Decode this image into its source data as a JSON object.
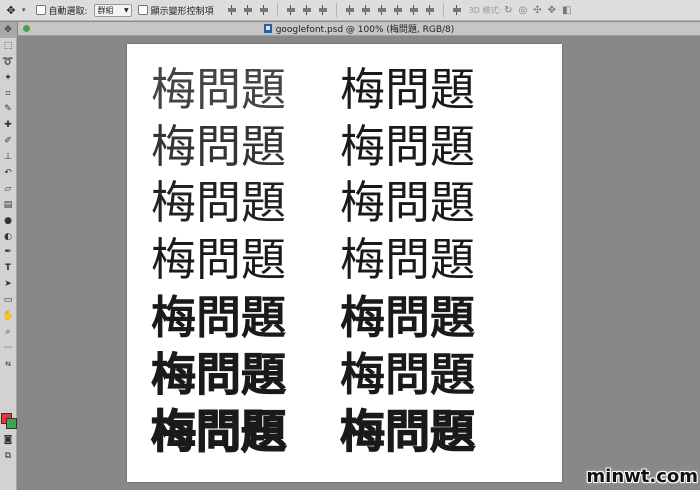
{
  "options_bar": {
    "auto_select_label": "自動選取:",
    "auto_select_value": "群組",
    "show_transform_label": "顯示變形控制項",
    "mode_label": "3D 模式:"
  },
  "document": {
    "tab_title": "googlefont.psd @ 100% (梅問題, RGB/8)"
  },
  "canvas": {
    "sample_text": "梅問題",
    "rows": [
      {
        "left": "梅問題",
        "right": "梅問題"
      },
      {
        "left": "梅問題",
        "right": "梅問題"
      },
      {
        "left": "梅問題",
        "right": "梅問題"
      },
      {
        "left": "梅問題",
        "right": "梅問題"
      },
      {
        "left": "梅問題",
        "right": "梅問題"
      },
      {
        "left": "梅問題",
        "right": "梅問題"
      },
      {
        "left": "梅問題",
        "right": "梅問題"
      }
    ]
  },
  "watermark": "minwt.com",
  "colors": {
    "foreground": "#e03a3a",
    "background": "#3aa84a",
    "workspace": "#888888"
  },
  "icons": {
    "move_tool": "move-icon",
    "marquee_tool": "marquee-icon",
    "lasso_tool": "lasso-icon",
    "magic_wand_tool": "magic-wand-icon",
    "crop_tool": "crop-icon",
    "eyedropper_tool": "eyedropper-icon",
    "healing_tool": "healing-icon",
    "brush_tool": "brush-icon",
    "stamp_tool": "stamp-icon",
    "history_brush_tool": "history-brush-icon",
    "eraser_tool": "eraser-icon",
    "gradient_tool": "gradient-icon",
    "blur_tool": "blur-icon",
    "dodge_tool": "dodge-icon",
    "pen_tool": "pen-icon",
    "type_tool": "type-icon",
    "path_select_tool": "path-select-icon",
    "shape_tool": "rectangle-icon",
    "hand_tool": "hand-icon",
    "zoom_tool": "zoom-icon"
  }
}
